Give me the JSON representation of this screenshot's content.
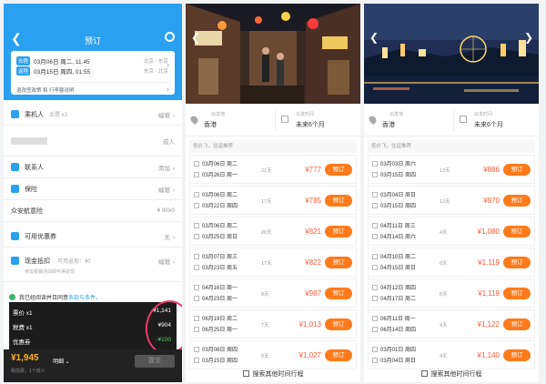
{
  "booking": {
    "title": "预订",
    "back_icon": "back-arrow-icon",
    "service_icon": "customer-service-icon",
    "trips": [
      {
        "tag": "去程",
        "date": "03月06日 周二, 11:45",
        "route": "北京 - 东京"
      },
      {
        "tag": "返程",
        "date": "03月15日 周四, 01:55",
        "route": "东京 - 北京"
      }
    ],
    "policy": "退改签政策 和 行李额说明",
    "rows": [
      {
        "label": "乘机人",
        "sub": "余票 x3",
        "right": "编辑"
      },
      {
        "label": "",
        "sub": "",
        "right": "成人"
      },
      {
        "label": "联系人",
        "sub": "",
        "right": "添加"
      },
      {
        "label": "保险",
        "sub": "",
        "right": "编辑"
      },
      {
        "label": "众安航意险",
        "sub": "",
        "right": "¥ 90x0"
      },
      {
        "label": "可用优惠券",
        "sub": "",
        "right": "无"
      },
      {
        "label": "现金抵扣",
        "sub": "可用返现：¥0",
        "right": "编辑"
      }
    ],
    "cash_note": "参加报销活动即可得返现",
    "agree_text": "我已经阅读并且同意",
    "agree_link": "条款与条件。",
    "prices": [
      {
        "label": "票价 x1",
        "value": "¥1,141"
      },
      {
        "label": "税费 x1",
        "value": "¥904"
      },
      {
        "label": "优惠券",
        "value": "-¥100"
      }
    ],
    "total": "¥1,945",
    "detail_label": "明细",
    "total_note": "税前费，1个成人",
    "submit": "提交"
  },
  "columns": [
    {
      "location_key": "出发地",
      "location": "香港",
      "time_key": "出发时间",
      "time": "未来6个月",
      "tip": "低价飞，往返推荐",
      "items": [
        {
          "out": "03月06日 周二",
          "ret": "03月26日 周一",
          "days": "21天",
          "price": "¥777"
        },
        {
          "out": "03月06日 周二",
          "ret": "03月22日 周四",
          "days": "17天",
          "price": "¥785"
        },
        {
          "out": "03月06日 周二",
          "ret": "03月25日 周日",
          "days": "20天",
          "price": "¥821"
        },
        {
          "out": "03月07日 周三",
          "ret": "03月23日 周五",
          "days": "17天",
          "price": "¥822"
        },
        {
          "out": "04月16日 周一",
          "ret": "04月23日 周一",
          "days": "8天",
          "price": "¥987"
        },
        {
          "out": "06月19日 周二",
          "ret": "06月25日 周一",
          "days": "7天",
          "price": "¥1,013"
        },
        {
          "out": "03月08日 周四",
          "ret": "03月15日 周四",
          "days": "8天",
          "price": "¥1,027"
        }
      ],
      "more": "搜索其他时间行程"
    },
    {
      "location_key": "出发地",
      "location": "香港",
      "time_key": "出发时间",
      "time": "未来6个月",
      "tip": "低价飞，往返推荐",
      "items": [
        {
          "out": "03月03日 周六",
          "ret": "03月15日 周四",
          "days": "13天",
          "price": "¥886"
        },
        {
          "out": "03月04日 周日",
          "ret": "03月15日 周四",
          "days": "12天",
          "price": "¥970"
        },
        {
          "out": "04月11日 周三",
          "ret": "04月14日 周六",
          "days": "4天",
          "price": "¥1,080"
        },
        {
          "out": "04月10日 周二",
          "ret": "04月15日 周日",
          "days": "6天",
          "price": "¥1,119"
        },
        {
          "out": "04月12日 周四",
          "ret": "04月17日 周二",
          "days": "6天",
          "price": "¥1,119"
        },
        {
          "out": "06月11日 周一",
          "ret": "06月14日 周四",
          "days": "4天",
          "price": "¥1,122"
        },
        {
          "out": "03月01日 周四",
          "ret": "03月04日 周日",
          "days": "4天",
          "price": "¥1,140"
        }
      ],
      "more": "搜索其他时间行程"
    }
  ],
  "book_label": "预订",
  "colors": {
    "accent": "#2aa0f0",
    "price": "#ff5a3a",
    "button": "#ff7a1a"
  }
}
